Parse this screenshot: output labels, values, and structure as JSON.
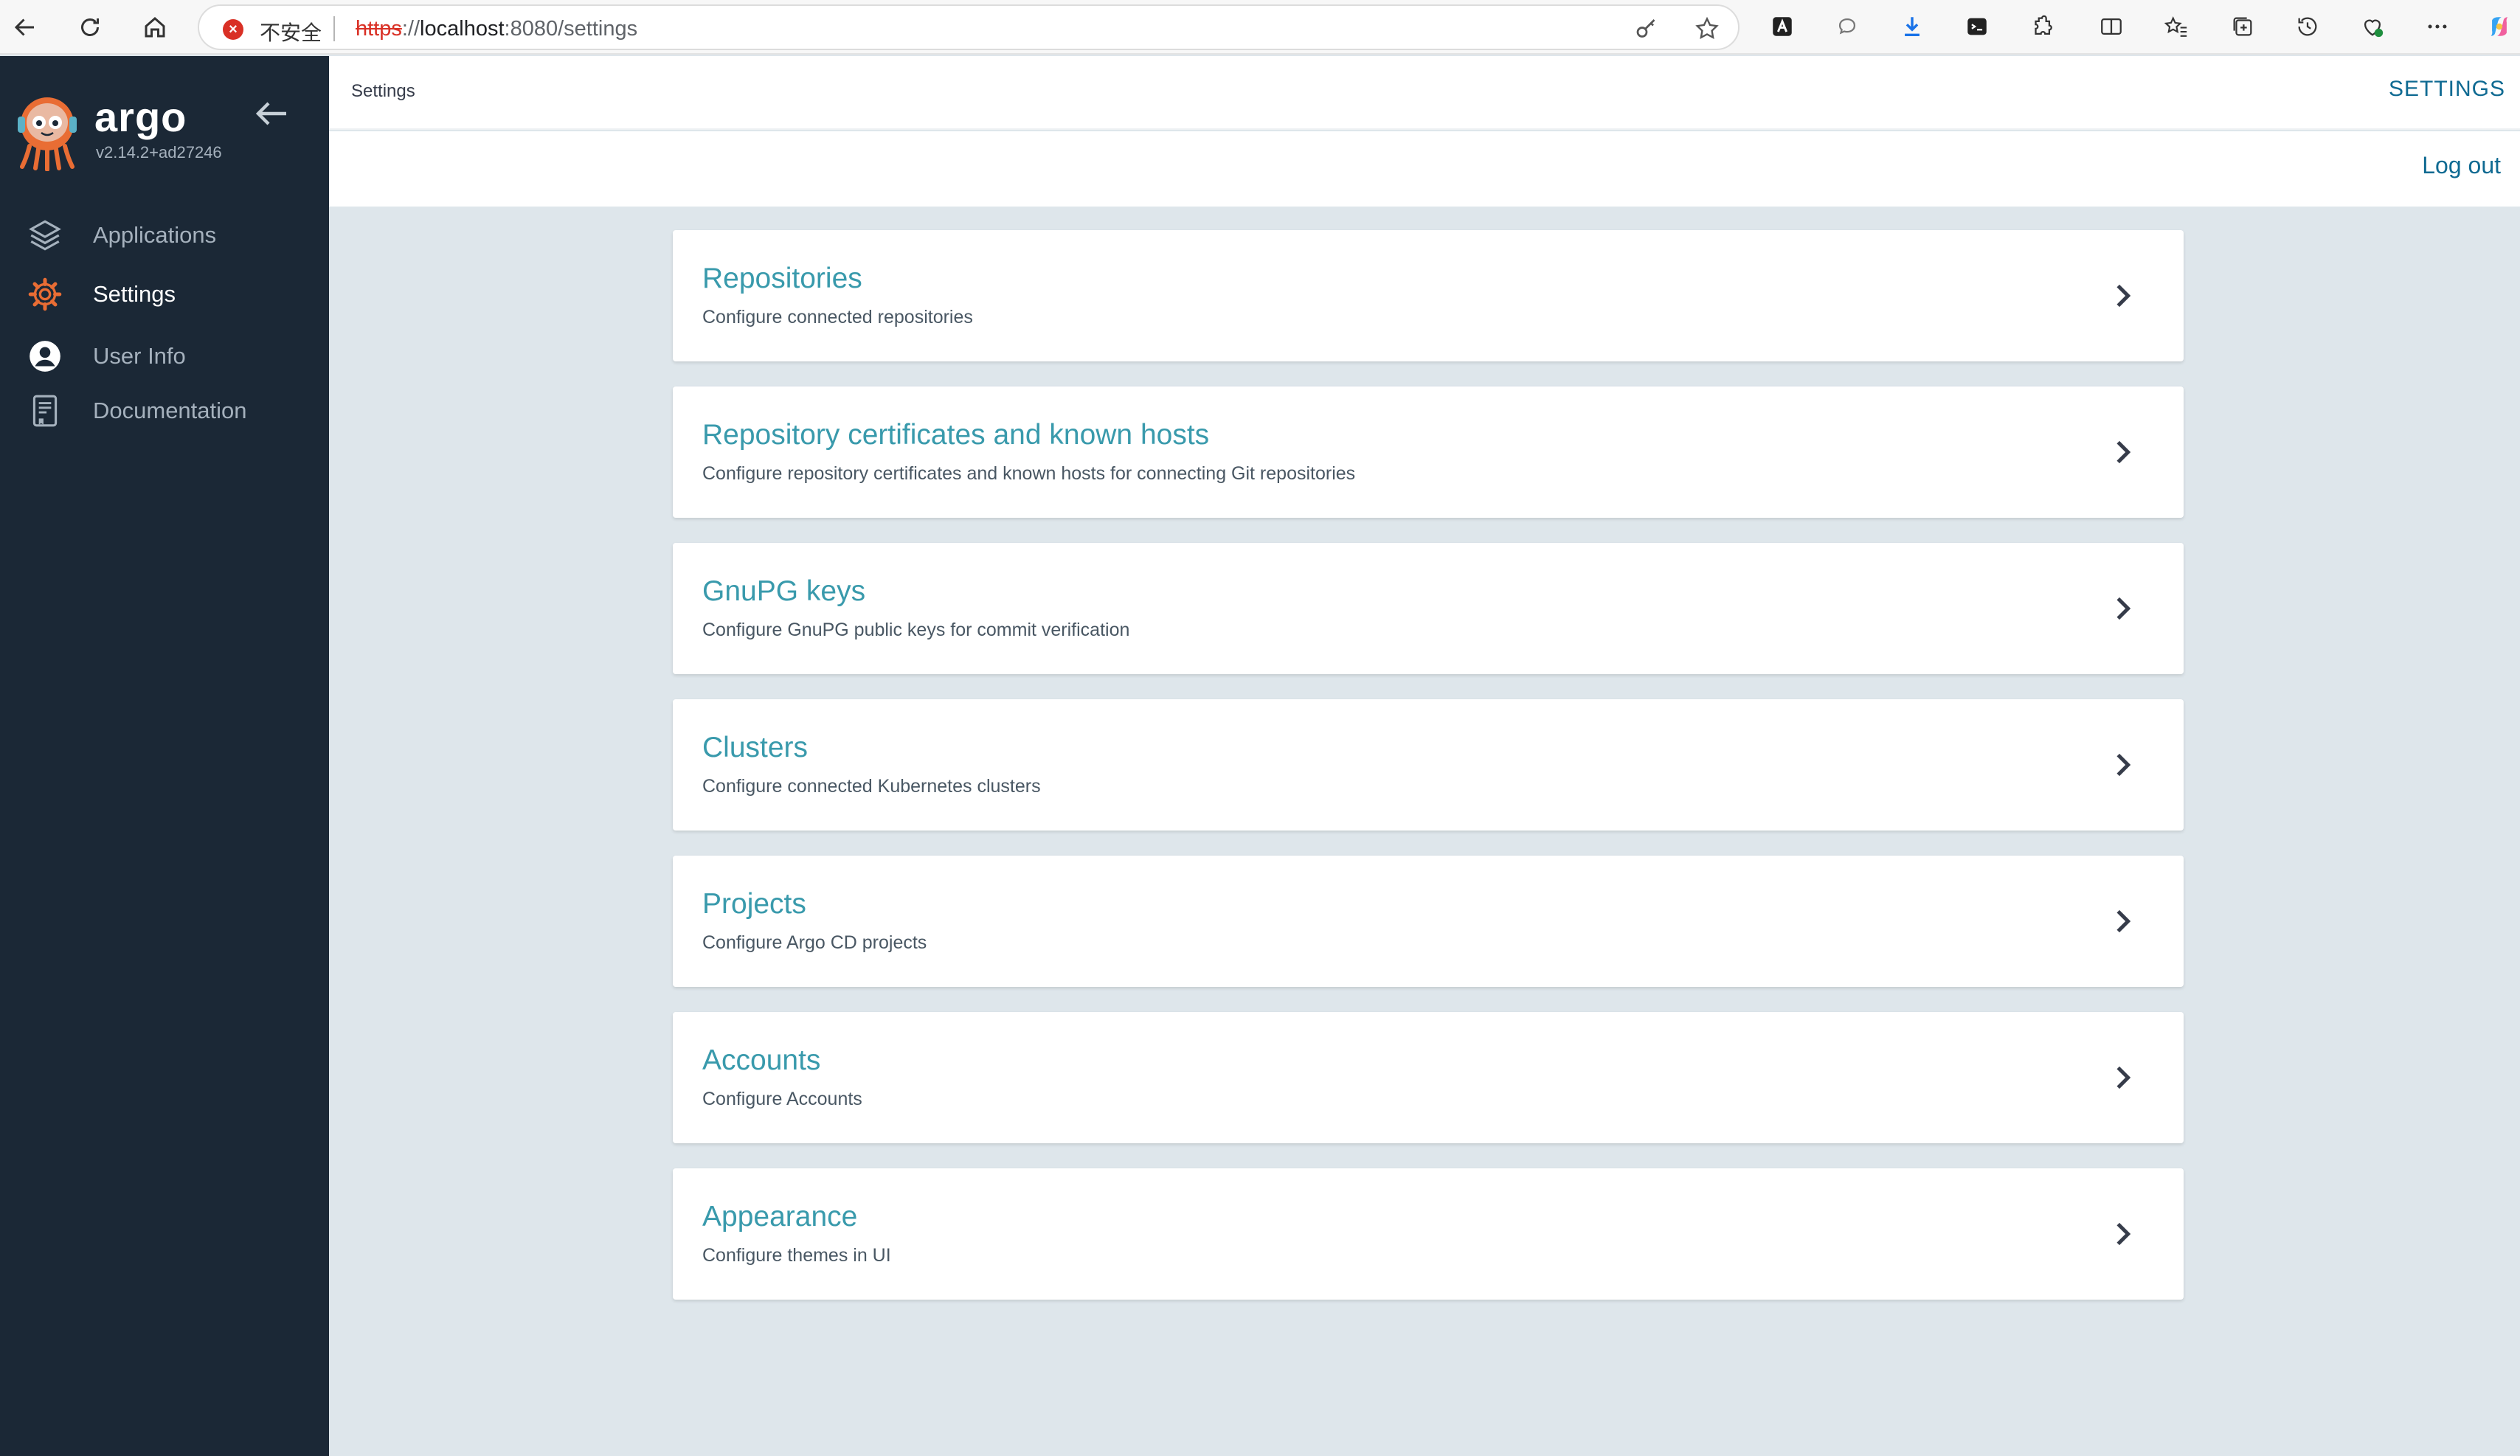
{
  "browser": {
    "security_label": "不安全",
    "url_scheme": "https",
    "url_separator": "://",
    "url_host": "localhost",
    "url_path": ":8080/settings"
  },
  "sidebar": {
    "brand": "argo",
    "version": "v2.14.2+ad27246",
    "items": [
      {
        "label": "Applications",
        "icon": "layers-icon",
        "active": false
      },
      {
        "label": "Settings",
        "icon": "gear-icon",
        "active": true
      },
      {
        "label": "User Info",
        "icon": "user-circle-icon",
        "active": false
      },
      {
        "label": "Documentation",
        "icon": "book-icon",
        "active": false
      }
    ]
  },
  "header": {
    "page_title": "Settings",
    "right_link": "SETTINGS",
    "logout": "Log out"
  },
  "settings_cards": [
    {
      "title": "Repositories",
      "description": "Configure connected repositories"
    },
    {
      "title": "Repository certificates and known hosts",
      "description": "Configure repository certificates and known hosts for connecting Git repositories"
    },
    {
      "title": "GnuPG keys",
      "description": "Configure GnuPG public keys for commit verification"
    },
    {
      "title": "Clusters",
      "description": "Configure connected Kubernetes clusters"
    },
    {
      "title": "Projects",
      "description": "Configure Argo CD projects"
    },
    {
      "title": "Accounts",
      "description": "Configure Accounts"
    },
    {
      "title": "Appearance",
      "description": "Configure themes in UI"
    }
  ],
  "colors": {
    "sidebar_bg": "#1b2836",
    "accent_link": "#0f6a92",
    "card_title": "#399aac",
    "content_bg": "#dee6eb",
    "argo_orange": "#e96d34"
  }
}
